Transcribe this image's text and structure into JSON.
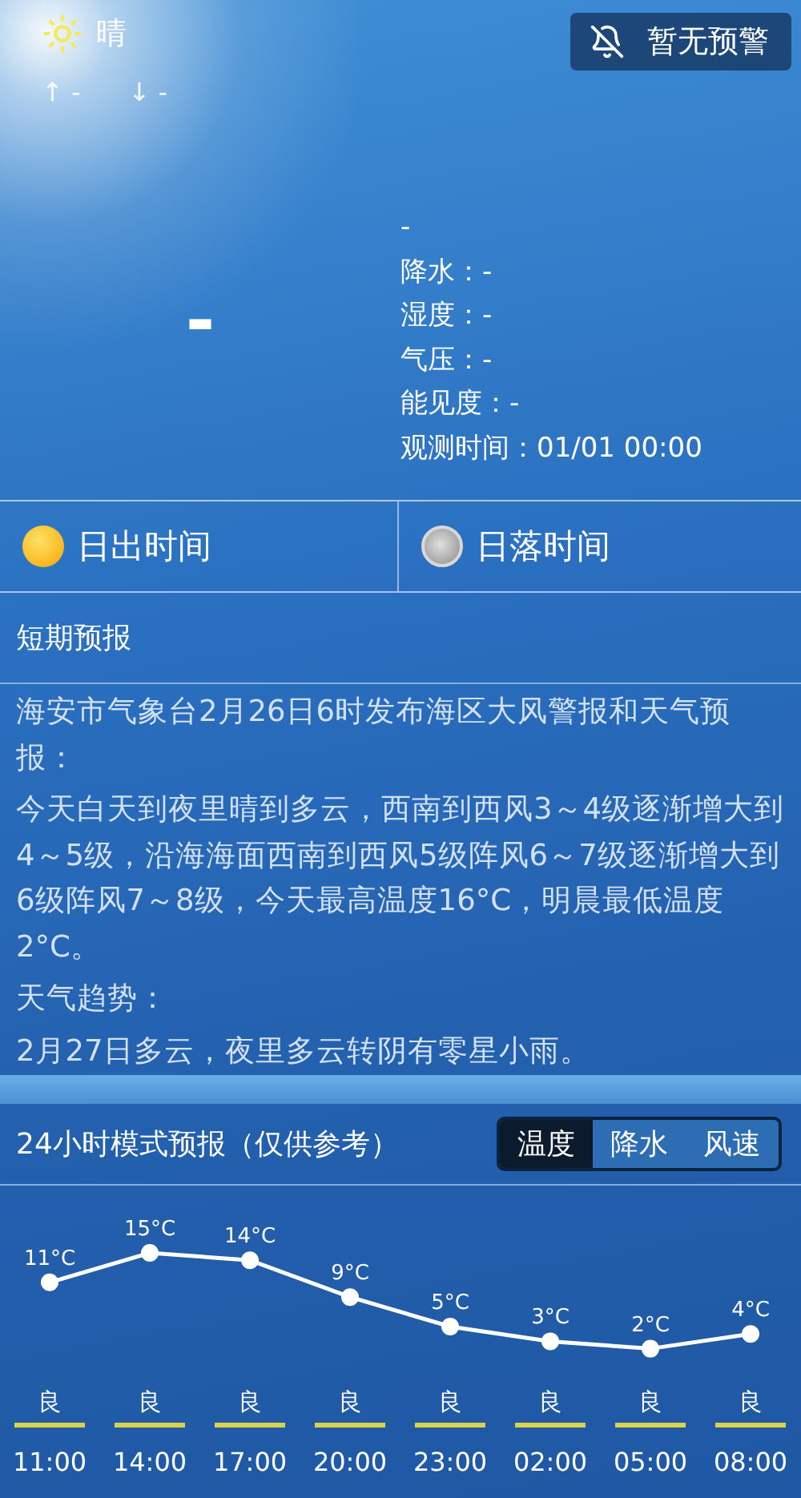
{
  "weather": {
    "condition": "晴",
    "high": "↑ -",
    "low": "↓ -",
    "temperature": "-"
  },
  "alert_button": {
    "label": "暂无预警"
  },
  "details": {
    "title": "-",
    "items": [
      "降水：-",
      "湿度：-",
      "气压：-",
      "能见度：-",
      "观测时间：01/01 00:00"
    ]
  },
  "sun_times": [
    {
      "kind": "sunrise",
      "label": "日出时间"
    },
    {
      "kind": "sunset",
      "label": "日落时间"
    }
  ],
  "short_forecast": {
    "title": "短期预报",
    "paragraphs": [
      "海安市气象台2月26日6时发布海区大风警报和天气预报：",
      "今天白天到夜里晴到多云，西南到西风3～4级逐渐增大到4～5级，沿海海面西南到西风5级阵风6～7级逐渐增大到6级阵风7～8级，今天最高温度16°C，明晨最低温度2°C。",
      "天气趋势：",
      "2月27日多云，夜里多云转阴有零星小雨。"
    ]
  },
  "hourly": {
    "title": "24小时模式预报（仅供参考）",
    "tabs": [
      {
        "label": "温度",
        "selected": true
      },
      {
        "label": "降水",
        "selected": false
      },
      {
        "label": "风速",
        "selected": false
      }
    ],
    "chart_data": {
      "type": "line",
      "categories": [
        "11:00",
        "14:00",
        "17:00",
        "20:00",
        "23:00",
        "02:00",
        "05:00",
        "08:00"
      ],
      "series": [
        {
          "color": "#ffffff",
          "marker": "circle",
          "values": [
            11,
            15,
            14,
            9,
            5,
            3,
            2,
            4
          ],
          "value_labels": [
            "11°C",
            "15°C",
            "14°C",
            "9°C",
            "5°C",
            "3°C",
            "2°C",
            "4°C"
          ]
        }
      ]
    },
    "air_quality": [
      "良",
      "良",
      "良",
      "良",
      "良",
      "良",
      "良",
      "良"
    ]
  }
}
